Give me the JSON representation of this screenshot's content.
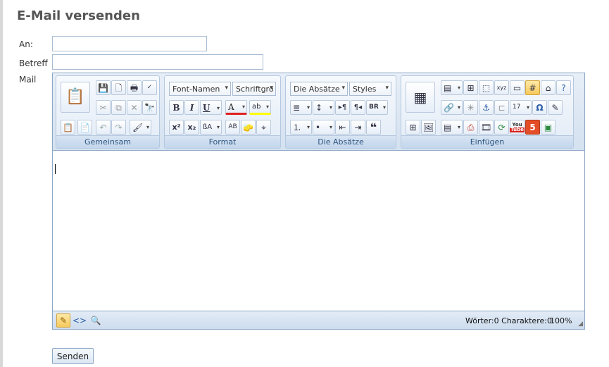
{
  "page": {
    "title": "E-Mail versenden"
  },
  "form": {
    "to_label": "An:",
    "to_value": "",
    "subject_label": "Betreff",
    "subject_value": "",
    "mail_label": "Mail",
    "send_label": "Senden"
  },
  "ribbon": {
    "groups": {
      "common": "Gemeinsam",
      "format": "Format",
      "paragraphs": "Die Absätze",
      "insert": "Einfügen"
    },
    "font_name": "Font-Namen",
    "font_size": "Schriftgrö",
    "paragraph_style": "Die Absätze",
    "styles": "Styles",
    "bold": "B",
    "italic": "I",
    "underline": "U",
    "font_color": "A",
    "highlight": "ab",
    "superscript": "x²",
    "subscript": "x₂",
    "quote": "❝",
    "youtube_line1": "You",
    "youtube_line2": "Tube",
    "html5": "5",
    "special_char": "Ω"
  },
  "status": {
    "counts": "Wörter:0 Charaktere:0",
    "zoom": "100%"
  },
  "colors": {
    "ribbon_bg": "#d4e1f0",
    "group_label": "#2e5580",
    "active_button": "#f7c95c",
    "youtube_red": "#d9251d",
    "html5_orange": "#e44d26",
    "font_color_underline": "#e02020",
    "highlight_yellow": "#ffff00"
  }
}
